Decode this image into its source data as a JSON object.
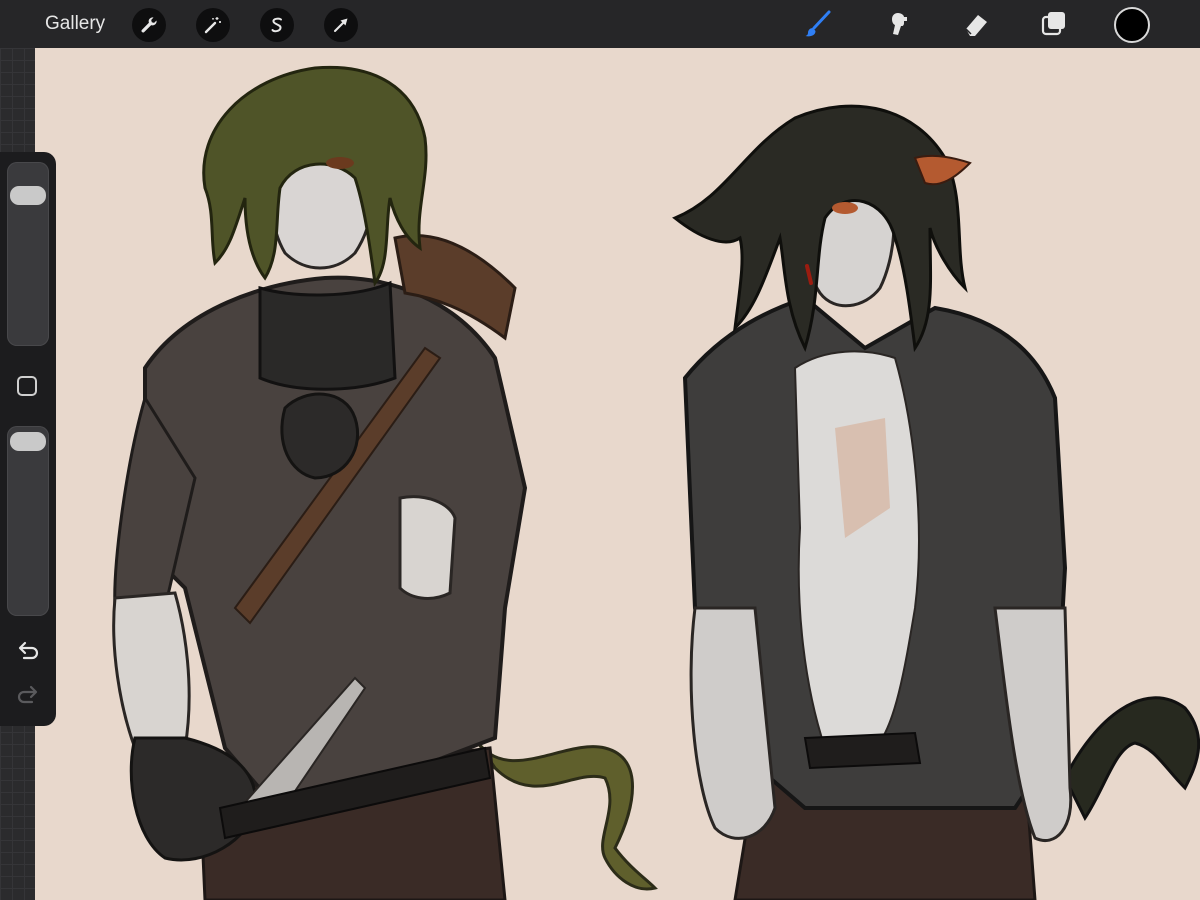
{
  "toolbar": {
    "gallery_label": "Gallery",
    "left_tools": [
      "wrench-icon",
      "magic-wand-icon",
      "selection-s-icon",
      "transform-arrow-icon"
    ],
    "right_tools": [
      "brush-icon",
      "smudge-icon",
      "eraser-icon",
      "layers-icon"
    ],
    "active_tool": "brush-icon",
    "active_tool_color": "#2f7ff5",
    "current_color": "#000000"
  },
  "sidebar": {
    "brush_size": 0.88,
    "opacity": 1.0,
    "controls": [
      "modify-button",
      "undo-arrow-icon",
      "redo-arrow-icon"
    ]
  },
  "canvas": {
    "background_color": "#e8d8cc",
    "subject": "two-figure-sketch"
  }
}
